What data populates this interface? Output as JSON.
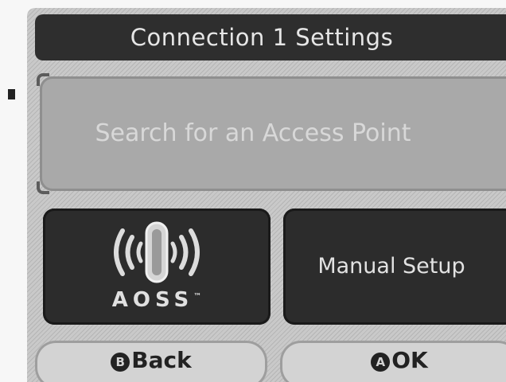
{
  "header": {
    "title": "Connection 1 Settings"
  },
  "options": {
    "search_label": "Search for an Access Point",
    "aoss_label": "AOSS",
    "aoss_tm": "™",
    "manual_label": "Manual Setup"
  },
  "footer": {
    "back_glyph": "B",
    "back_label": "Back",
    "ok_glyph": "A",
    "ok_label": "OK"
  },
  "colors": {
    "title_bar": "#2e2e2e",
    "search_button": "#a9a9a9",
    "dark_button": "#2c2c2c",
    "bottom_button": "#d3d3d3"
  },
  "icons": {
    "aoss": "aoss-wireless-icon",
    "pointer": "selection-pointer-icon"
  }
}
